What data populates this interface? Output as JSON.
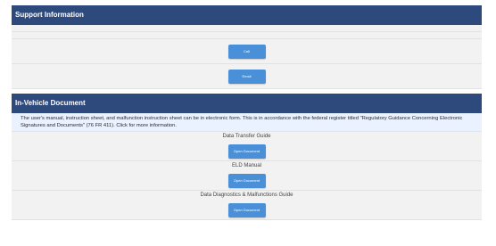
{
  "support": {
    "header": "Support Information",
    "call_label": "Call",
    "email_label": "Email"
  },
  "in_vehicle": {
    "header": "In-Vehicle Document",
    "notice": "The user's manual, instruction sheet, and malfunction instruction sheet can be in electronic form. This is in accordance with the federal register titled \"Regulatory Guidance Concerning Electronic Signatures and Documents\" (76 FR 411). Click for more information.",
    "documents": [
      {
        "title": "Data Transfer Guide",
        "button": "Open Document"
      },
      {
        "title": "ELD Manual",
        "button": "Open Document"
      },
      {
        "title": "Data Diagnostics & Malfunctions Guide",
        "button": "Open Document"
      }
    ]
  },
  "colors": {
    "header_bg": "#2e4a7d",
    "button_bg": "#4a90d9",
    "notice_bg": "#eaf1ff"
  }
}
